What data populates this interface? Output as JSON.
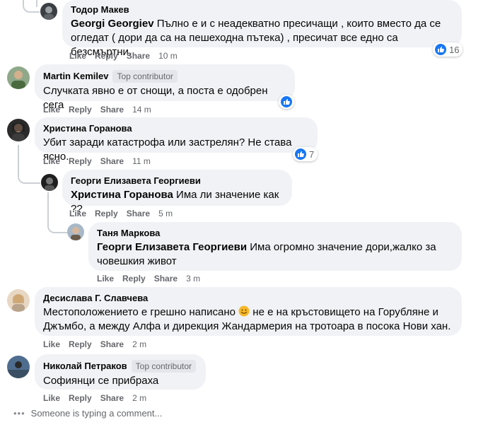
{
  "comments": [
    {
      "author": "Тодор Макев",
      "badge": null,
      "mention": "Georgi Georgiev",
      "text_line1": " Пълно е и с неадекватно пресичащи , които вместо да се",
      "text_line2": "огледат ( дори да са на пешеходна пътека) , пресичат все едно са безсмъртни.",
      "actions": {
        "like": "Like",
        "reply": "Reply",
        "share": "Share",
        "time": "10 m"
      },
      "reactions": "16"
    },
    {
      "author": "Martin Kemilev",
      "badge": "Top contributor",
      "text": "Случката явно е от снощи, а поста е одобрен сега",
      "actions": {
        "like": "Like",
        "reply": "Reply",
        "share": "Share",
        "time": "14 m"
      },
      "reactions": ""
    },
    {
      "author": "Христина Горанова",
      "badge": null,
      "text": "Убит заради катастрофа или застрелян? Не става ясно.",
      "actions": {
        "like": "Like",
        "reply": "Reply",
        "share": "Share",
        "time": "11 m"
      },
      "reactions": "7"
    },
    {
      "author": "Георги Елизавета Георгиеви",
      "badge": null,
      "mention": "Христина Горанова",
      "text": " Има ли значение как ??",
      "actions": {
        "like": "Like",
        "reply": "Reply",
        "share": "Share",
        "time": "5 m"
      }
    },
    {
      "author": "Таня Маркова",
      "badge": null,
      "mention": "Георги Елизавета Георгиеви",
      "text_line1": " Има огромно значение дори,жалко за",
      "text_line2": "човешкия живот",
      "actions": {
        "like": "Like",
        "reply": "Reply",
        "share": "Share",
        "time": "3 m"
      }
    },
    {
      "author": "Десислава Г. Славчева",
      "badge": null,
      "text_line1a": "Местоположението е грешно написано ",
      "emoji": "smiling-face-emoji",
      "text_line1b": " не е на кръстовището на Горубляне и",
      "text_line2": "Джъмбо, а между Алфа и дирекция Жандармерия на тротоара в посока Нови хан.",
      "actions": {
        "like": "Like",
        "reply": "Reply",
        "share": "Share",
        "time": "2 m"
      }
    },
    {
      "author": "Николай Петраков",
      "badge": "Top contributor",
      "text": "Софиянци се прибраха",
      "actions": {
        "like": "Like",
        "reply": "Reply",
        "share": "Share",
        "time": "2 m"
      }
    }
  ],
  "typing_indicator": {
    "dots": "•••",
    "text": "Someone is typing a comment..."
  },
  "colors": {
    "bubble": "#f0f2f5",
    "like_blue": "#1877f2",
    "meta_gray": "#65676b",
    "thread_line": "#ccd0d5"
  }
}
